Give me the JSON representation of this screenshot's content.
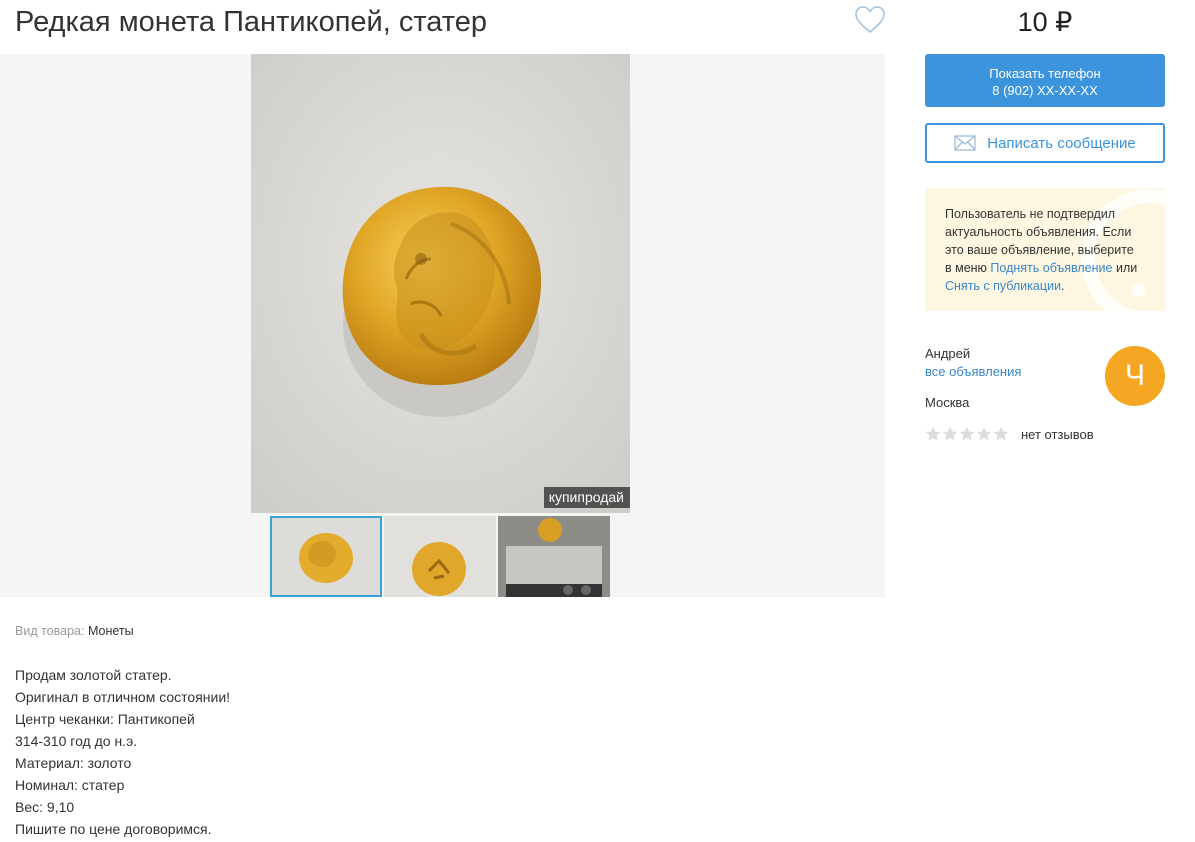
{
  "listing": {
    "title": "Редкая монета Пантикопей, статер",
    "price": "10 ₽"
  },
  "gallery": {
    "watermark": "купипродай",
    "thumbnail_count": 3,
    "active_thumbnail": 1
  },
  "contact": {
    "phone_button_label": "Показать телефон",
    "phone_masked": "8 (902) XX-XX-XX",
    "message_button_label": "Написать сообщение"
  },
  "notice": {
    "text_before": "Пользователь не подтвердил актуальность объявления. Если это ваше объявление, выберите в меню ",
    "link_raise": "Поднять объявление",
    "text_or": " или ",
    "link_remove": "Снять с публикации",
    "text_end": "."
  },
  "seller": {
    "name": "Андрей",
    "all_listings_link": "все объявления",
    "avatar_letter": "Ч",
    "avatar_color": "#f5a623",
    "city": "Москва",
    "rating_stars_filled": 0,
    "rating_stars_total": 5,
    "reviews_text": "нет отзывов"
  },
  "details": {
    "category_label": "Вид товара:",
    "category_value": "Монеты"
  },
  "description": {
    "lines": [
      "Продам золотой статер.",
      "Оригинал в отличном состоянии!",
      "Центр чеканки: Пантикопей",
      "314-310 год до н.э.",
      "Материал: золото",
      "Номинал: статер",
      "Вес: 9,10",
      "Пишите по цене договоримся."
    ]
  },
  "colors": {
    "accent": "#3c94dc",
    "notice_bg": "#fdf7e1",
    "link": "#3a86c8"
  }
}
